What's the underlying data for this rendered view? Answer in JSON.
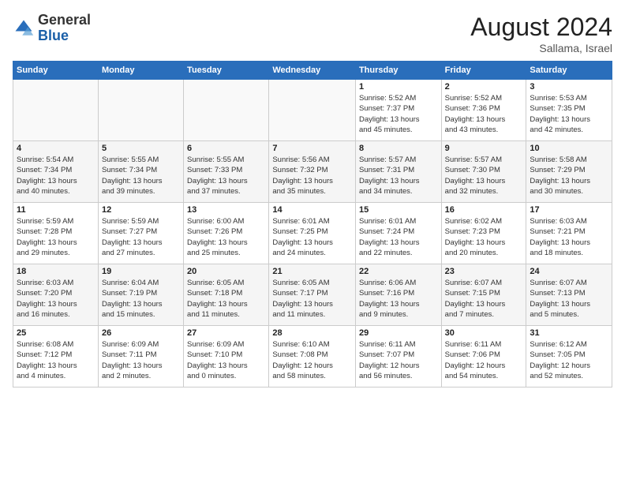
{
  "header": {
    "logo_general": "General",
    "logo_blue": "Blue",
    "month_year": "August 2024",
    "location": "Sallama, Israel"
  },
  "days_of_week": [
    "Sunday",
    "Monday",
    "Tuesday",
    "Wednesday",
    "Thursday",
    "Friday",
    "Saturday"
  ],
  "weeks": [
    [
      {
        "num": "",
        "info": ""
      },
      {
        "num": "",
        "info": ""
      },
      {
        "num": "",
        "info": ""
      },
      {
        "num": "",
        "info": ""
      },
      {
        "num": "1",
        "info": "Sunrise: 5:52 AM\nSunset: 7:37 PM\nDaylight: 13 hours\nand 45 minutes."
      },
      {
        "num": "2",
        "info": "Sunrise: 5:52 AM\nSunset: 7:36 PM\nDaylight: 13 hours\nand 43 minutes."
      },
      {
        "num": "3",
        "info": "Sunrise: 5:53 AM\nSunset: 7:35 PM\nDaylight: 13 hours\nand 42 minutes."
      }
    ],
    [
      {
        "num": "4",
        "info": "Sunrise: 5:54 AM\nSunset: 7:34 PM\nDaylight: 13 hours\nand 40 minutes."
      },
      {
        "num": "5",
        "info": "Sunrise: 5:55 AM\nSunset: 7:34 PM\nDaylight: 13 hours\nand 39 minutes."
      },
      {
        "num": "6",
        "info": "Sunrise: 5:55 AM\nSunset: 7:33 PM\nDaylight: 13 hours\nand 37 minutes."
      },
      {
        "num": "7",
        "info": "Sunrise: 5:56 AM\nSunset: 7:32 PM\nDaylight: 13 hours\nand 35 minutes."
      },
      {
        "num": "8",
        "info": "Sunrise: 5:57 AM\nSunset: 7:31 PM\nDaylight: 13 hours\nand 34 minutes."
      },
      {
        "num": "9",
        "info": "Sunrise: 5:57 AM\nSunset: 7:30 PM\nDaylight: 13 hours\nand 32 minutes."
      },
      {
        "num": "10",
        "info": "Sunrise: 5:58 AM\nSunset: 7:29 PM\nDaylight: 13 hours\nand 30 minutes."
      }
    ],
    [
      {
        "num": "11",
        "info": "Sunrise: 5:59 AM\nSunset: 7:28 PM\nDaylight: 13 hours\nand 29 minutes."
      },
      {
        "num": "12",
        "info": "Sunrise: 5:59 AM\nSunset: 7:27 PM\nDaylight: 13 hours\nand 27 minutes."
      },
      {
        "num": "13",
        "info": "Sunrise: 6:00 AM\nSunset: 7:26 PM\nDaylight: 13 hours\nand 25 minutes."
      },
      {
        "num": "14",
        "info": "Sunrise: 6:01 AM\nSunset: 7:25 PM\nDaylight: 13 hours\nand 24 minutes."
      },
      {
        "num": "15",
        "info": "Sunrise: 6:01 AM\nSunset: 7:24 PM\nDaylight: 13 hours\nand 22 minutes."
      },
      {
        "num": "16",
        "info": "Sunrise: 6:02 AM\nSunset: 7:23 PM\nDaylight: 13 hours\nand 20 minutes."
      },
      {
        "num": "17",
        "info": "Sunrise: 6:03 AM\nSunset: 7:21 PM\nDaylight: 13 hours\nand 18 minutes."
      }
    ],
    [
      {
        "num": "18",
        "info": "Sunrise: 6:03 AM\nSunset: 7:20 PM\nDaylight: 13 hours\nand 16 minutes."
      },
      {
        "num": "19",
        "info": "Sunrise: 6:04 AM\nSunset: 7:19 PM\nDaylight: 13 hours\nand 15 minutes."
      },
      {
        "num": "20",
        "info": "Sunrise: 6:05 AM\nSunset: 7:18 PM\nDaylight: 13 hours\nand 11 minutes."
      },
      {
        "num": "21",
        "info": "Sunrise: 6:05 AM\nSunset: 7:17 PM\nDaylight: 13 hours\nand 11 minutes."
      },
      {
        "num": "22",
        "info": "Sunrise: 6:06 AM\nSunset: 7:16 PM\nDaylight: 13 hours\nand 9 minutes."
      },
      {
        "num": "23",
        "info": "Sunrise: 6:07 AM\nSunset: 7:15 PM\nDaylight: 13 hours\nand 7 minutes."
      },
      {
        "num": "24",
        "info": "Sunrise: 6:07 AM\nSunset: 7:13 PM\nDaylight: 13 hours\nand 5 minutes."
      }
    ],
    [
      {
        "num": "25",
        "info": "Sunrise: 6:08 AM\nSunset: 7:12 PM\nDaylight: 13 hours\nand 4 minutes."
      },
      {
        "num": "26",
        "info": "Sunrise: 6:09 AM\nSunset: 7:11 PM\nDaylight: 13 hours\nand 2 minutes."
      },
      {
        "num": "27",
        "info": "Sunrise: 6:09 AM\nSunset: 7:10 PM\nDaylight: 13 hours\nand 0 minutes."
      },
      {
        "num": "28",
        "info": "Sunrise: 6:10 AM\nSunset: 7:08 PM\nDaylight: 12 hours\nand 58 minutes."
      },
      {
        "num": "29",
        "info": "Sunrise: 6:11 AM\nSunset: 7:07 PM\nDaylight: 12 hours\nand 56 minutes."
      },
      {
        "num": "30",
        "info": "Sunrise: 6:11 AM\nSunset: 7:06 PM\nDaylight: 12 hours\nand 54 minutes."
      },
      {
        "num": "31",
        "info": "Sunrise: 6:12 AM\nSunset: 7:05 PM\nDaylight: 12 hours\nand 52 minutes."
      }
    ]
  ]
}
